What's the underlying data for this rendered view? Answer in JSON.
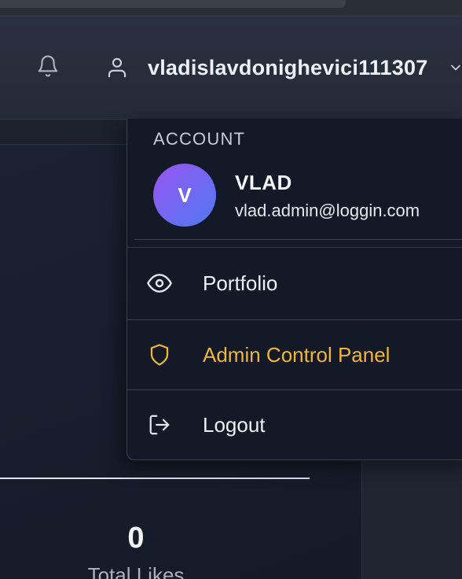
{
  "header": {
    "username": "vladislavdonighevici111307",
    "icons": {
      "notifications": "bell-icon",
      "user": "user-icon",
      "dropdown": "chevron-down-icon"
    }
  },
  "dropdown": {
    "section_label": "ACCOUNT",
    "avatar_initial": "V",
    "name": "VLAD",
    "email": "vlad.admin@loggin.com",
    "items": [
      {
        "label": "Portfolio",
        "icon": "eye-icon"
      },
      {
        "label": "Admin Control Panel",
        "icon": "shield-icon",
        "color": "#f2b536"
      },
      {
        "label": "Logout",
        "icon": "logout-icon"
      }
    ]
  },
  "stats": {
    "value": "0",
    "label": "Total Likes"
  },
  "colors": {
    "accent_admin": "#f2b536",
    "avatar_gradient_start": "#9a55f2",
    "avatar_gradient_end": "#4e79f1",
    "dropdown_bg": "#131926",
    "header_bg": "#293140"
  }
}
